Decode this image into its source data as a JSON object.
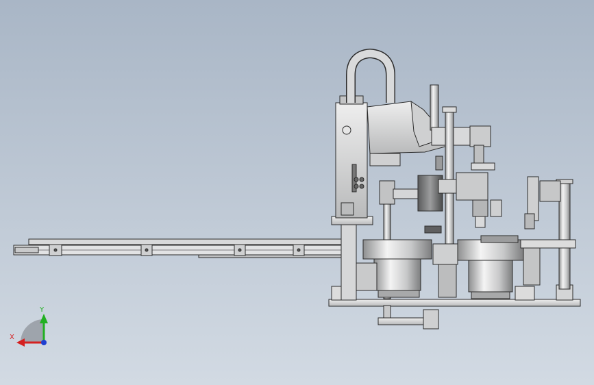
{
  "viewport": {
    "background_top": "#a9b6c6",
    "background_bottom": "#d2dae3",
    "model_fill": "#d9dadb",
    "model_stroke": "#2b2b2b"
  },
  "triad": {
    "x_label": "X",
    "y_label": "Y",
    "x_color": "#d42020",
    "y_color": "#22b022",
    "z_color": "#1f3fd0"
  }
}
